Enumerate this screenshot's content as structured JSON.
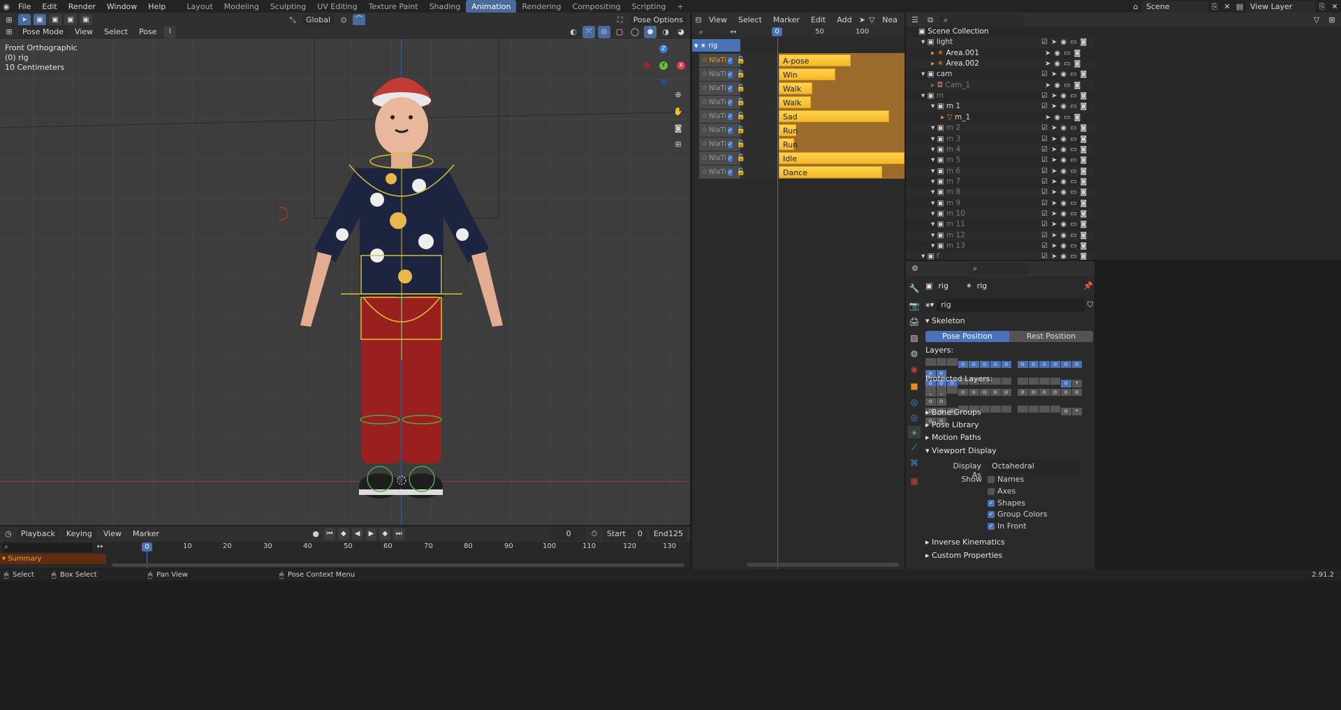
{
  "topbar": {
    "menus": [
      "File",
      "Edit",
      "Render",
      "Window",
      "Help"
    ],
    "workspaces": [
      "Layout",
      "Modeling",
      "Sculpting",
      "UV Editing",
      "Texture Paint",
      "Shading",
      "Animation",
      "Rendering",
      "Compositing",
      "Scripting"
    ],
    "active_workspace": "Animation",
    "scene_label": "Scene",
    "view_layer_label": "View Layer"
  },
  "viewport": {
    "mode": "Pose Mode",
    "menus": [
      "View",
      "Select",
      "Pose"
    ],
    "orientation": "Global",
    "pose_options": "Pose Options",
    "overlay_lines": [
      "Front Orthographic",
      "(0) rig",
      "10 Centimeters"
    ]
  },
  "nla": {
    "menus": [
      "View",
      "Select",
      "Marker",
      "Edit",
      "Add"
    ],
    "truncated_label": "Nea",
    "ruler": [
      "0",
      "50",
      "100"
    ],
    "rig_label": "rig",
    "track_label": "NlaTi",
    "strips": [
      "A-pose",
      "Win",
      "Walk (RM)",
      "Walk",
      "Sad",
      "Run",
      "Run",
      "Idle",
      "Dance"
    ]
  },
  "outliner": {
    "root": "Scene Collection",
    "rows": [
      {
        "label": "light",
        "type": "collection"
      },
      {
        "label": "Area.001",
        "type": "light"
      },
      {
        "label": "Area.002",
        "type": "light"
      },
      {
        "label": "cam",
        "type": "collection"
      },
      {
        "label": "Cam_1",
        "type": "camera"
      },
      {
        "label": "m",
        "type": "collection"
      },
      {
        "label": "m 1",
        "type": "collection"
      },
      {
        "label": "m_1",
        "type": "mesh"
      },
      {
        "label": "m 2",
        "type": "collection"
      },
      {
        "label": "m 3",
        "type": "collection"
      },
      {
        "label": "m 4",
        "type": "collection"
      },
      {
        "label": "m 5",
        "type": "collection"
      },
      {
        "label": "m 6",
        "type": "collection"
      },
      {
        "label": "m 7",
        "type": "collection"
      },
      {
        "label": "m 8",
        "type": "collection"
      },
      {
        "label": "m 9",
        "type": "collection"
      },
      {
        "label": "m 10",
        "type": "collection"
      },
      {
        "label": "m 11",
        "type": "collection"
      },
      {
        "label": "m 12",
        "type": "collection"
      },
      {
        "label": "m 13",
        "type": "collection"
      },
      {
        "label": "f",
        "type": "collection"
      }
    ]
  },
  "properties": {
    "crumb_a": "rig",
    "crumb_b": "rig",
    "datablock": "rig",
    "skeleton": "Skeleton",
    "pose_position": "Pose Position",
    "rest_position": "Rest Position",
    "layers": "Layers:",
    "protected_layers": "Protected Layers:",
    "sections": [
      "Bone Groups",
      "Pose Library",
      "Motion Paths",
      "Viewport Display"
    ],
    "display_as_label": "Display As",
    "display_as_value": "Octahedral",
    "show_label": "Show",
    "show_items": [
      {
        "label": "Names",
        "checked": false
      },
      {
        "label": "Axes",
        "checked": false
      },
      {
        "label": "Shapes",
        "checked": true
      },
      {
        "label": "Group Colors",
        "checked": true
      },
      {
        "label": "In Front",
        "checked": true
      }
    ],
    "bottom_sections": [
      "Inverse Kinematics",
      "Custom Properties"
    ]
  },
  "timeline": {
    "menus": [
      "Playback",
      "Keying",
      "View",
      "Marker"
    ],
    "current_frame": "0",
    "start_label": "Start",
    "start": "0",
    "end_label": "End",
    "end": "125",
    "ruler": [
      "0",
      "10",
      "20",
      "30",
      "40",
      "50",
      "60",
      "70",
      "80",
      "90",
      "100",
      "110",
      "120",
      "130"
    ],
    "summary": "Summary"
  },
  "status": {
    "select": "Select",
    "box_select": "Box Select",
    "pan_view": "Pan View",
    "context": "Pose Context Menu",
    "version": "2.91.2"
  },
  "colors": {
    "accent": "#4a72b8",
    "strip": "#f5b728",
    "active_tab": "#4a6a9c"
  }
}
